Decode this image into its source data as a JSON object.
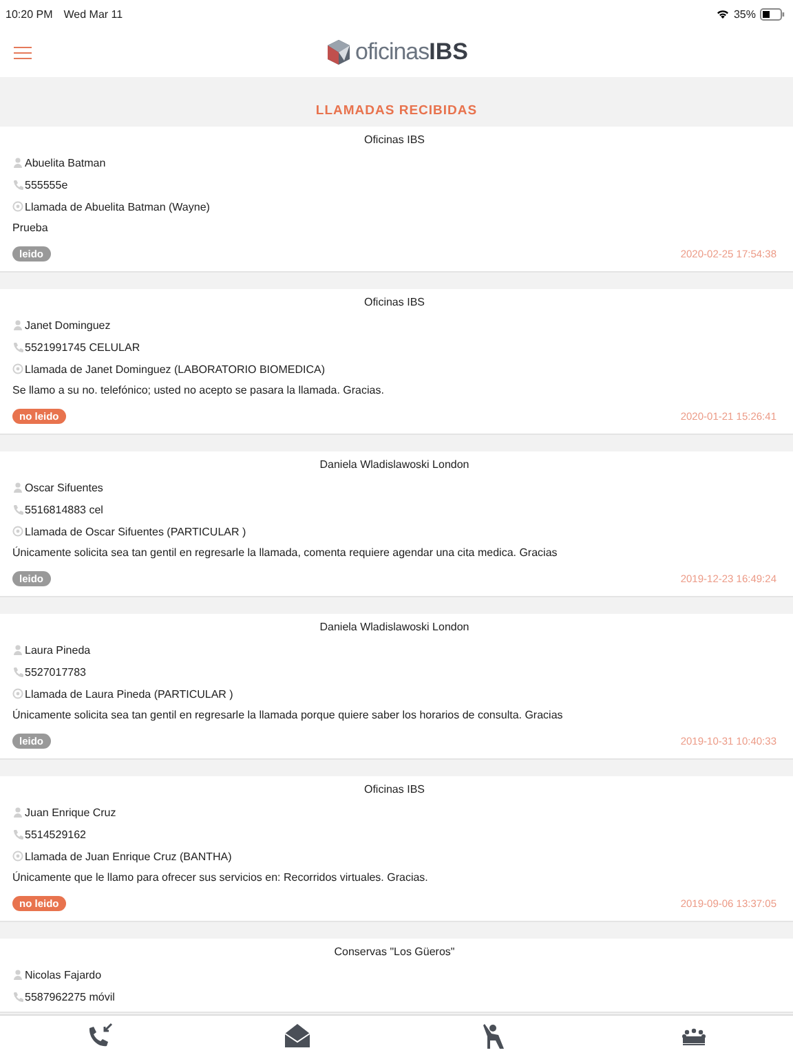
{
  "status_bar": {
    "time": "10:20 PM",
    "date": "Wed Mar 11",
    "battery": "35%"
  },
  "header": {
    "logo_text_light": "oficinas",
    "logo_text_bold": "IBS"
  },
  "title": "LLAMADAS RECIBIDAS",
  "calls": [
    {
      "company": "Oficinas IBS",
      "contact": "Abuelita Batman",
      "phone": "555555e",
      "subject": "Llamada de Abuelita Batman (Wayne)",
      "message": "Prueba",
      "read": true,
      "status": "leido",
      "date": "2020-02-25 17:54:38"
    },
    {
      "company": "Oficinas IBS",
      "contact": "Janet Dominguez",
      "phone": "5521991745 CELULAR",
      "subject": "Llamada de Janet Dominguez (LABORATORIO BIOMEDICA)",
      "message": "Se llamo a su no. telefónico; usted no acepto se pasara la llamada. Gracias.",
      "read": false,
      "status": "no leido",
      "date": "2020-01-21 15:26:41"
    },
    {
      "company": "Daniela Wladislawoski London",
      "contact": "Oscar Sifuentes",
      "phone": "5516814883 cel",
      "subject": "Llamada de Oscar Sifuentes (PARTICULAR )",
      "message": "Únicamente solicita sea tan gentil en regresarle la llamada, comenta requiere agendar una cita medica.  Gracias",
      "read": true,
      "status": "leido",
      "date": "2019-12-23 16:49:24"
    },
    {
      "company": "Daniela Wladislawoski London",
      "contact": "Laura Pineda",
      "phone": "5527017783",
      "subject": "Llamada de Laura Pineda (PARTICULAR )",
      "message": "Únicamente solicita sea tan gentil en regresarle la llamada porque quiere saber los horarios de consulta. Gracias",
      "read": true,
      "status": "leido",
      "date": "2019-10-31 10:40:33"
    },
    {
      "company": "Oficinas IBS",
      "contact": "Juan Enrique Cruz",
      "phone": "5514529162",
      "subject": "Llamada de Juan Enrique Cruz (BANTHA)",
      "message": "Únicamente que le llamo para ofrecer sus servicios en: Recorridos virtuales.  Gracias.",
      "read": false,
      "status": "no leido",
      "date": "2019-09-06 13:37:05"
    },
    {
      "company": "Conservas \"Los Güeros\"",
      "contact": "Nicolas Fajardo",
      "phone": "5587962275 móvil"
    }
  ],
  "tab_bar": [
    {
      "kind": "calls"
    },
    {
      "kind": "mail"
    },
    {
      "kind": "visitor"
    },
    {
      "kind": "meeting"
    }
  ]
}
